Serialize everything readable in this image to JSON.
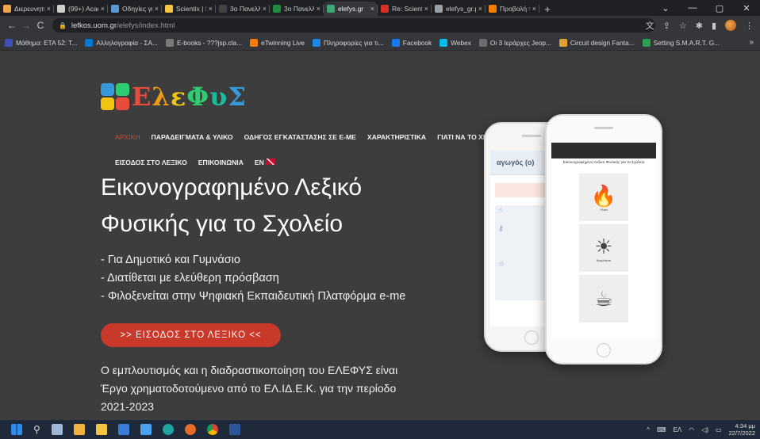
{
  "tabs": [
    {
      "label": "Διερευνητι",
      "color": "#f0a44b"
    },
    {
      "label": "(99+) Acad",
      "color": "#cfcfcf"
    },
    {
      "label": "Οδηγίες γι",
      "color": "#5b9bd5"
    },
    {
      "label": "Scientix | Sc",
      "color": "#f5c542"
    },
    {
      "label": "3ο Πανελλ",
      "color": "#444444"
    },
    {
      "label": "3ο Πανελλ",
      "color": "#1e8e3e"
    },
    {
      "label": "elefys.gr",
      "color": "#3aa676"
    },
    {
      "label": "Re: Scientix",
      "color": "#d93025"
    },
    {
      "label": "elefys_gr.p",
      "color": "#9aa0a6"
    },
    {
      "label": "Προβολή τ",
      "color": "#f57c00"
    }
  ],
  "tab_close": "×",
  "new_tab": "+",
  "window_controls": {
    "minimize": "⌄",
    "min2": "—",
    "max": "▢",
    "close": "✕"
  },
  "nav": {
    "back": "←",
    "forward": "→",
    "reload": "C"
  },
  "url": {
    "host": "lefkos.uom.gr",
    "path": "/elefys/index.html"
  },
  "bookmarks": [
    {
      "label": "Μάθημα: ΕΤΑ 52: Τ...",
      "color": "#3f51b5"
    },
    {
      "label": "Αλληλογραφία - ΣΑ...",
      "color": "#0078d4"
    },
    {
      "label": "E-books - ???jsp.cla...",
      "color": "#7a7a7a"
    },
    {
      "label": "eTwinning Live",
      "color": "#f57c00"
    },
    {
      "label": "Πληροφορίες για τι...",
      "color": "#1e88e5"
    },
    {
      "label": "Facebook",
      "color": "#1877f2"
    },
    {
      "label": "Webex",
      "color": "#00bceb"
    },
    {
      "label": "Οι 3 Ιεράρχες Jeop...",
      "color": "#6d6d6d"
    },
    {
      "label": "Circuit design Fanta...",
      "color": "#e0a030"
    },
    {
      "label": "Setting S.M.A.R.T. G...",
      "color": "#2e9e4f"
    }
  ],
  "bookmarks_more": "»",
  "logo": {
    "letters": [
      "Ε",
      "λ",
      "ε",
      "Φ",
      "υ",
      "Σ"
    ]
  },
  "menu": {
    "row1": [
      "ΑΡΧΙΚΗ",
      "ΠΑΡΑΔΕΙΓΜΑΤΑ & ΥΛΙΚΟ",
      "ΟΔΗΓΟΣ ΕΓΚΑΤΑΣΤΑΣΗΣ ΣΕ E-ME",
      "ΧΑΡΑΚΤΗΡΙΣΤΙΚΑ",
      "ΓΙΑΤΙ ΝΑ ΤΟ ΧΡ"
    ],
    "row2": [
      "ΕΙΣΟΔΟΣ ΣΤΟ ΛΕΞΙΚΟ",
      "ΕΠΙΚΟΙΝΩΝΙΑ",
      "EN"
    ]
  },
  "hero": {
    "title_line1": "Εικονογραφημένο Λεξικό",
    "title_line2": "Φυσικής για το Σχολείο",
    "bullets": [
      "- Για Δημοτικό και Γυμνάσιο",
      "- Διατίθεται με ελεύθερη πρόσβαση",
      "- Φιλοξενείται στην Ψηφιακή Εκπαιδευτική Πλατφόρμα e-me"
    ],
    "cta": ">> ΕΙΣΟΔΟΣ ΣΤΟ ΛΕΞΙΚΟ <<",
    "funding_line1": "Ο εμπλουτισμός και η διαδραστικοποίηση του ΕΛΕΦΥΣ είναι",
    "funding_line2": "Έργο χρηματοδοτούμενο από το ΕΛ.ΙΔ.Ε.Κ. για την περίοδο",
    "funding_line3": "2021-2023"
  },
  "phone_back": {
    "heading": "αγωγός (ο)"
  },
  "phone_front": {
    "title": "Εικονογραφημένο Λεξικό Φυσικής για το Σχολείο",
    "cards": [
      {
        "label": "Υλικό"
      },
      {
        "label": "θερμότητα"
      },
      {
        "label": ""
      }
    ]
  },
  "taskbar": {
    "lang": "ΕΛ",
    "time": "4:34 μμ",
    "date": "22/7/2022",
    "tray_up": "^"
  }
}
